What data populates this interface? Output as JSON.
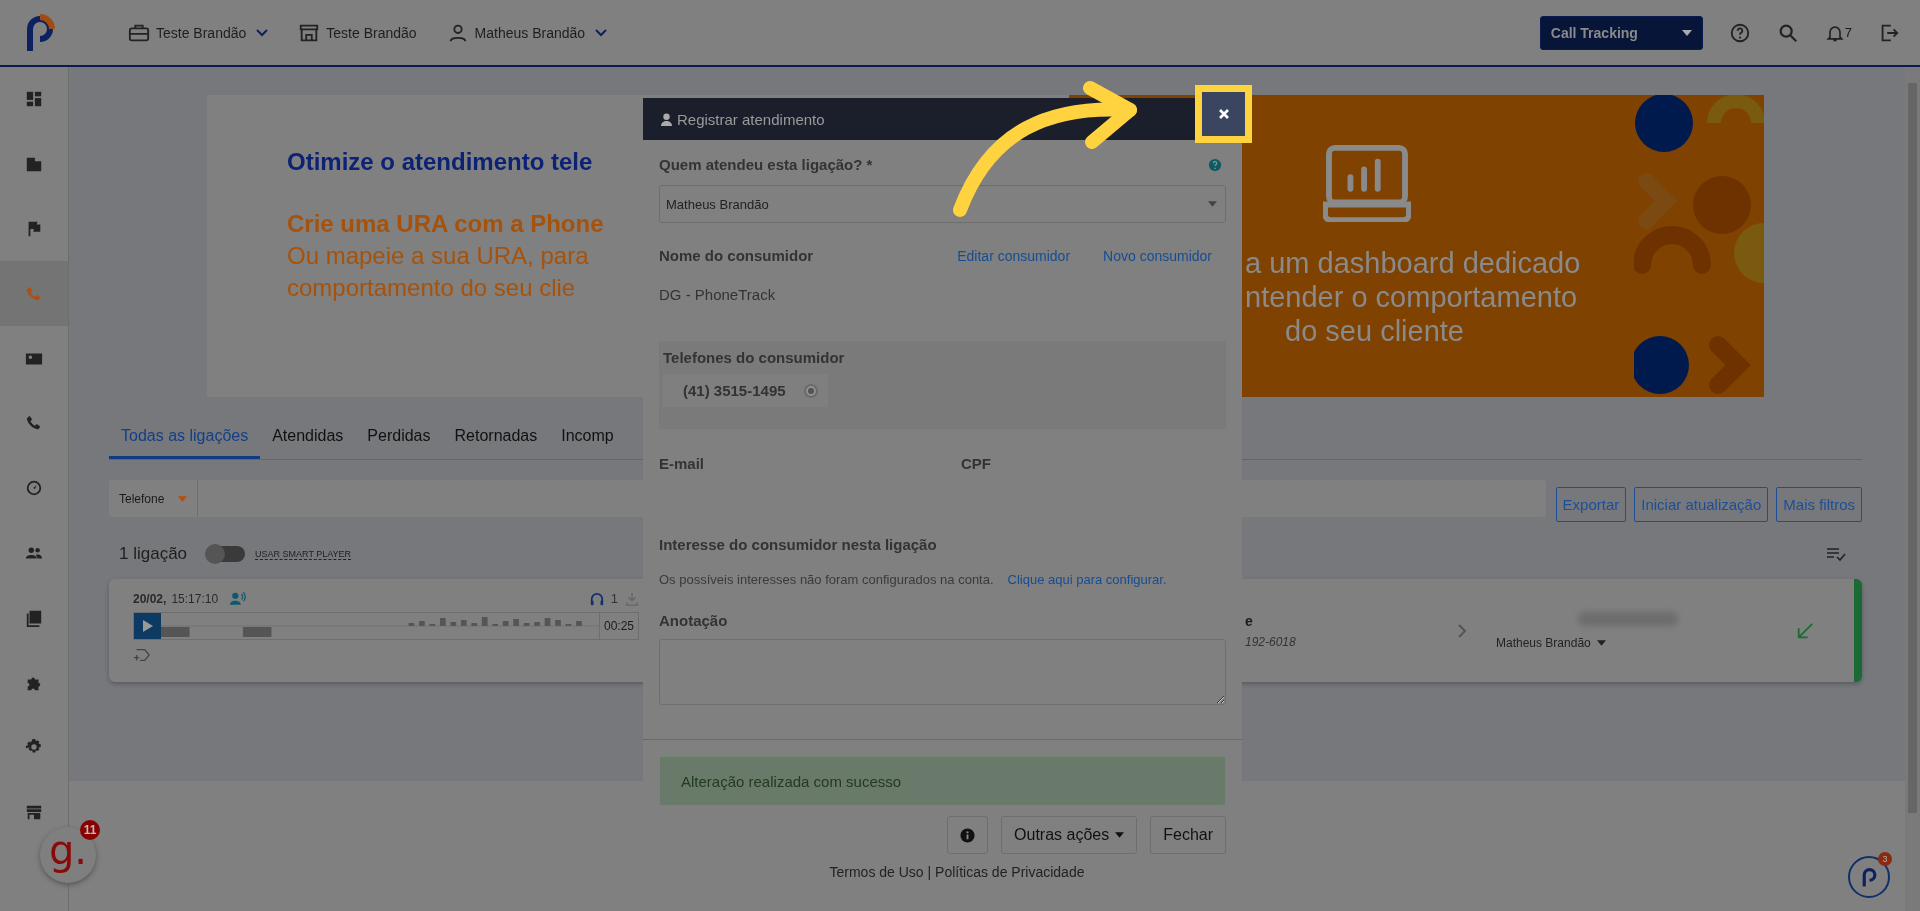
{
  "topbar": {
    "nav": [
      {
        "kind": "briefcase",
        "label": "Teste Brandão",
        "dropdown": true
      },
      {
        "kind": "store",
        "label": "Teste Brandão",
        "dropdown": false
      },
      {
        "kind": "user",
        "label": "Matheus Brandão",
        "dropdown": true
      }
    ],
    "product_select": "Call Tracking",
    "notifications": "7"
  },
  "sidebar": {
    "items": [
      {
        "selected": false
      },
      {
        "selected": false
      },
      {
        "selected": false
      },
      {
        "selected": true
      },
      {
        "selected": false
      },
      {
        "selected": false
      },
      {
        "selected": false
      },
      {
        "selected": false
      },
      {
        "selected": false
      },
      {
        "selected": false
      },
      {
        "selected": false
      },
      {
        "selected": false
      }
    ]
  },
  "banner": {
    "headline": "Otimize o atendimento tele",
    "subheadline": "Crie uma URA com a Phone",
    "body_lines": [
      "Ou mapeie a sua URA, para",
      "comportamento do seu clie"
    ],
    "right_lines": [
      "a um dashboard dedicado",
      "ntender o comportamento",
      "do seu cliente"
    ]
  },
  "tabs": [
    {
      "label": "Todas as ligações",
      "selected": true
    },
    {
      "label": "Atendidas",
      "selected": false
    },
    {
      "label": "Perdidas",
      "selected": false
    },
    {
      "label": "Retornadas",
      "selected": false
    },
    {
      "label": "Incomp",
      "selected": false
    }
  ],
  "filter": {
    "label": "Telefone"
  },
  "actions": [
    "Exportar",
    "Iniciar atualização",
    "Mais filtros"
  ],
  "count": "1 ligação",
  "smart_player": {
    "label": "USAR SMART PLAYER",
    "on": false
  },
  "calls": [
    {
      "date": "20/02,",
      "time": "15:17:10",
      "listens": "1",
      "duration": "00:25",
      "name_fragment": "e",
      "phone_fragment": "192-6018",
      "attendant": "Matheus Brandão"
    }
  ],
  "footer": "Termos de Uso | Políticas de Privacidade",
  "chat_logo": "g.",
  "chat_badge": "11",
  "help_badge": "3",
  "modal": {
    "title": "Registrar atendimento",
    "who_label": "Quem atendeu esta ligação? *",
    "who_value": "Matheus Brandão",
    "name_label": "Nome do consumidor",
    "edit_link": "Editar consumidor",
    "new_link": "Novo consumidor",
    "name_value": "DG - PhoneTrack",
    "phones_label": "Telefones do consumidor",
    "phones": [
      {
        "number": "(41) 3515-1495",
        "selected": true
      }
    ],
    "email_label": "E-mail",
    "cpf_label": "CPF",
    "interest_label": "Interesse do consumidor nesta ligação",
    "interest_text": "Os possíveis interesses não foram configurados na conta.",
    "interest_link": "Clique aqui para configurar.",
    "note_label": "Anotação",
    "alert": "Alteração realizada com sucesso",
    "more_actions": "Outras ações",
    "close_label": "Fechar"
  }
}
